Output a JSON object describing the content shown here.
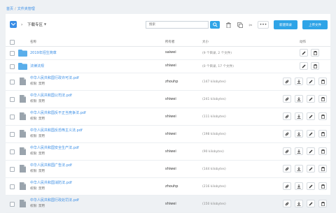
{
  "breadcrumb": {
    "home": "首页",
    "current": "文件夹管理"
  },
  "toolbar": {
    "current_folder": "下载专区",
    "search_placeholder": "搜索",
    "more_label": "•••",
    "new_folder_label": "新建目录",
    "upload_label": "上传文件"
  },
  "table": {
    "headers": {
      "name": "名称",
      "owner": "所有者",
      "size": "大小",
      "actions": "动作"
    },
    "folders": [
      {
        "name": "2019年招生简章",
        "owner": "saiwei",
        "size": "(9 个目录, 2 个文件)"
      },
      {
        "name": "法律法规",
        "owner": "shiwei",
        "size": "(0 个目录, 17 个文件)"
      }
    ],
    "files": [
      {
        "name": "中华人民共和国行政许可法.pdf",
        "perm": "权限: 禁用",
        "owner": "zhouhp",
        "size": "(147 kilobytes)"
      },
      {
        "name": "中华人民共和国公司法.pdf",
        "perm": "权限: 禁用",
        "owner": "shiwei",
        "size": "(241 kilobytes)"
      },
      {
        "name": "中华人民共和国反不正当竞争法.pdf",
        "perm": "权限: 禁用",
        "owner": "shiwei",
        "size": "(111 kilobytes)"
      },
      {
        "name": "中华人民共和国反恐怖主义法.pdf",
        "perm": "权限: 禁用",
        "owner": "shiwei",
        "size": "(198 kilobytes)"
      },
      {
        "name": "中华人民共和国安全生产法.pdf",
        "perm": "权限: 禁用",
        "owner": "shiwei",
        "size": "(90 kilobytes)"
      },
      {
        "name": "中华人民共和国广告法.pdf",
        "perm": "权限: 禁用",
        "owner": "shiwei",
        "size": "(144 kilobytes)"
      },
      {
        "name": "中华人民共和国消防法.pdf",
        "perm": "权限: 禁用",
        "owner": "zhouhp",
        "size": "(216 kilobytes)"
      },
      {
        "name": "中华人民共和国行政处罚法.pdf",
        "perm": "权限: 禁用",
        "owner": "shiwei",
        "size": "(150 kilobytes)"
      }
    ]
  },
  "colors": {
    "accent": "#2fa4e7",
    "link": "#3a8ee6",
    "folder": "#5aaeea"
  },
  "icons": {
    "folder_icon": "folder-icon",
    "file_icon": "file-icon",
    "search_icon": "search-icon",
    "delete_icon": "trash-icon",
    "copy_icon": "copy-icon",
    "cut_icon": "scissors-icon",
    "link_icon": "link-icon",
    "download_icon": "download-icon",
    "edit_icon": "pencil-icon"
  }
}
